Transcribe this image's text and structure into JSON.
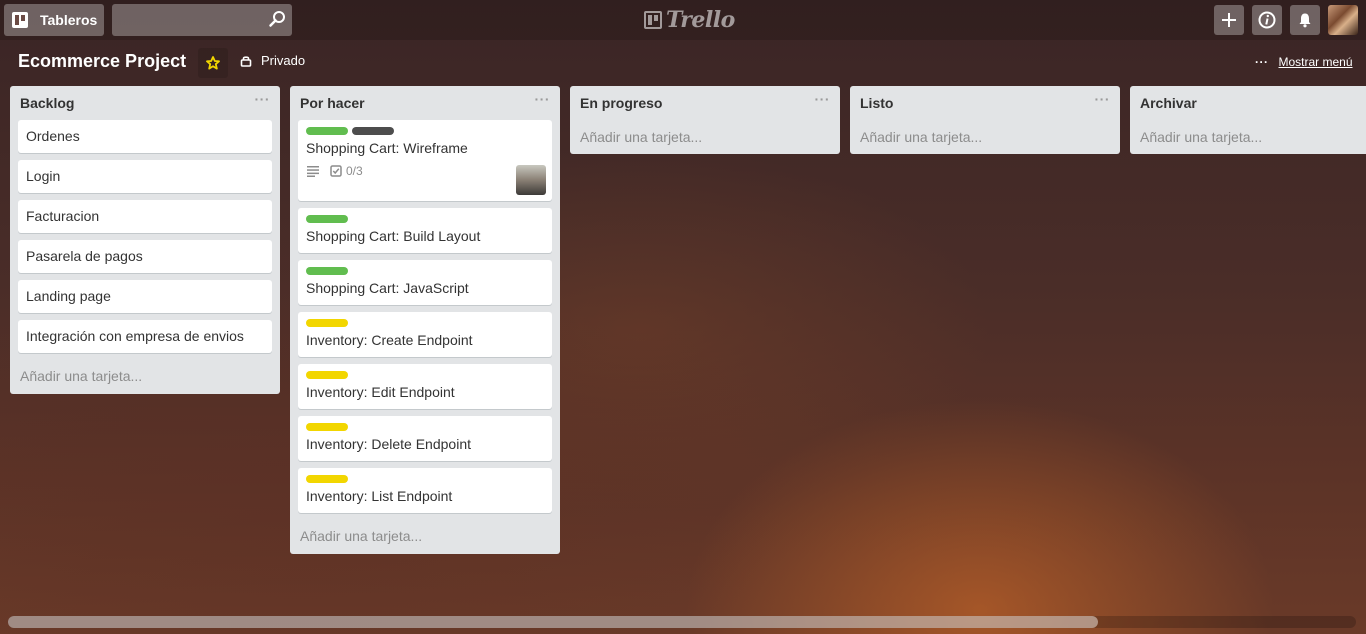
{
  "header": {
    "boards_label": "Tableros",
    "search_value": "",
    "logo_text": "Trello",
    "icons": {
      "boards": "boards-icon",
      "search": "search-icon",
      "add": "plus-icon",
      "info": "info-icon",
      "notifications": "bell-icon",
      "avatar": "user-avatar"
    }
  },
  "board": {
    "title": "Ecommerce Project",
    "starred": true,
    "visibility": "Privado",
    "menu_dots": "···",
    "menu_label": "Mostrar menú",
    "star_color": "#f2d600"
  },
  "lists": [
    {
      "title": "Backlog",
      "menu": "···",
      "add_card": "Añadir una tarjeta...",
      "cards": [
        {
          "title": "Ordenes"
        },
        {
          "title": "Login"
        },
        {
          "title": "Facturacion"
        },
        {
          "title": "Pasarela de pagos"
        },
        {
          "title": "Landing page"
        },
        {
          "title": "Integración con empresa de envios"
        }
      ]
    },
    {
      "title": "Por hacer",
      "menu": "···",
      "add_card": "Añadir una tarjeta...",
      "cards": [
        {
          "title": "Shopping Cart: Wireframe",
          "labels": [
            "green",
            "dark"
          ],
          "has_description": true,
          "checklist": "0/3",
          "member": "member-avatar"
        },
        {
          "title": "Shopping Cart: Build Layout",
          "labels": [
            "green"
          ]
        },
        {
          "title": "Shopping Cart: JavaScript",
          "labels": [
            "green"
          ]
        },
        {
          "title": "Inventory: Create Endpoint",
          "labels": [
            "yellow"
          ]
        },
        {
          "title": "Inventory: Edit Endpoint",
          "labels": [
            "yellow"
          ]
        },
        {
          "title": "Inventory: Delete Endpoint",
          "labels": [
            "yellow"
          ]
        },
        {
          "title": "Inventory: List Endpoint",
          "labels": [
            "yellow"
          ]
        }
      ]
    },
    {
      "title": "En progreso",
      "menu": "···",
      "add_card": "Añadir una tarjeta...",
      "cards": []
    },
    {
      "title": "Listo",
      "menu": "···",
      "add_card": "Añadir una tarjeta...",
      "cards": []
    },
    {
      "title": "Archivar",
      "menu": "···",
      "add_card": "Añadir una tarjeta...",
      "cards": []
    }
  ],
  "label_colors": {
    "green": "#61bd4f",
    "dark": "#4d4d4d",
    "yellow": "#f2d600"
  },
  "list_background": "#e2e4e6"
}
